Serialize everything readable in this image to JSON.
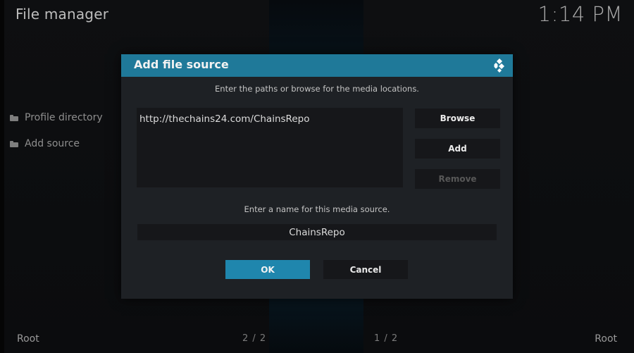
{
  "app": {
    "title": "File manager",
    "clock": "1:14 PM"
  },
  "left_pane": {
    "items": [
      {
        "label": "Profile directory",
        "icon": "folder-icon"
      },
      {
        "label": "Add source",
        "icon": "folder-icon"
      }
    ],
    "footer_label": "Root",
    "page_count": "2 / 2"
  },
  "right_pane": {
    "footer_label": "Root",
    "page_count": "1 / 2"
  },
  "dialog": {
    "title": "Add file source",
    "logo_icon": "kodi-logo-icon",
    "paths_instruction": "Enter the paths or browse for the media locations.",
    "paths": [
      "http://thechains24.com/ChainsRepo"
    ],
    "buttons": {
      "browse": "Browse",
      "add": "Add",
      "remove": "Remove",
      "ok": "OK",
      "cancel": "Cancel"
    },
    "name_instruction": "Enter a name for this media source.",
    "name_value": "ChainsRepo"
  },
  "colors": {
    "accent": "#1f7999",
    "ok_button": "#1f86ad",
    "dialog_bg": "#1e2125",
    "field_bg": "#16171a"
  }
}
